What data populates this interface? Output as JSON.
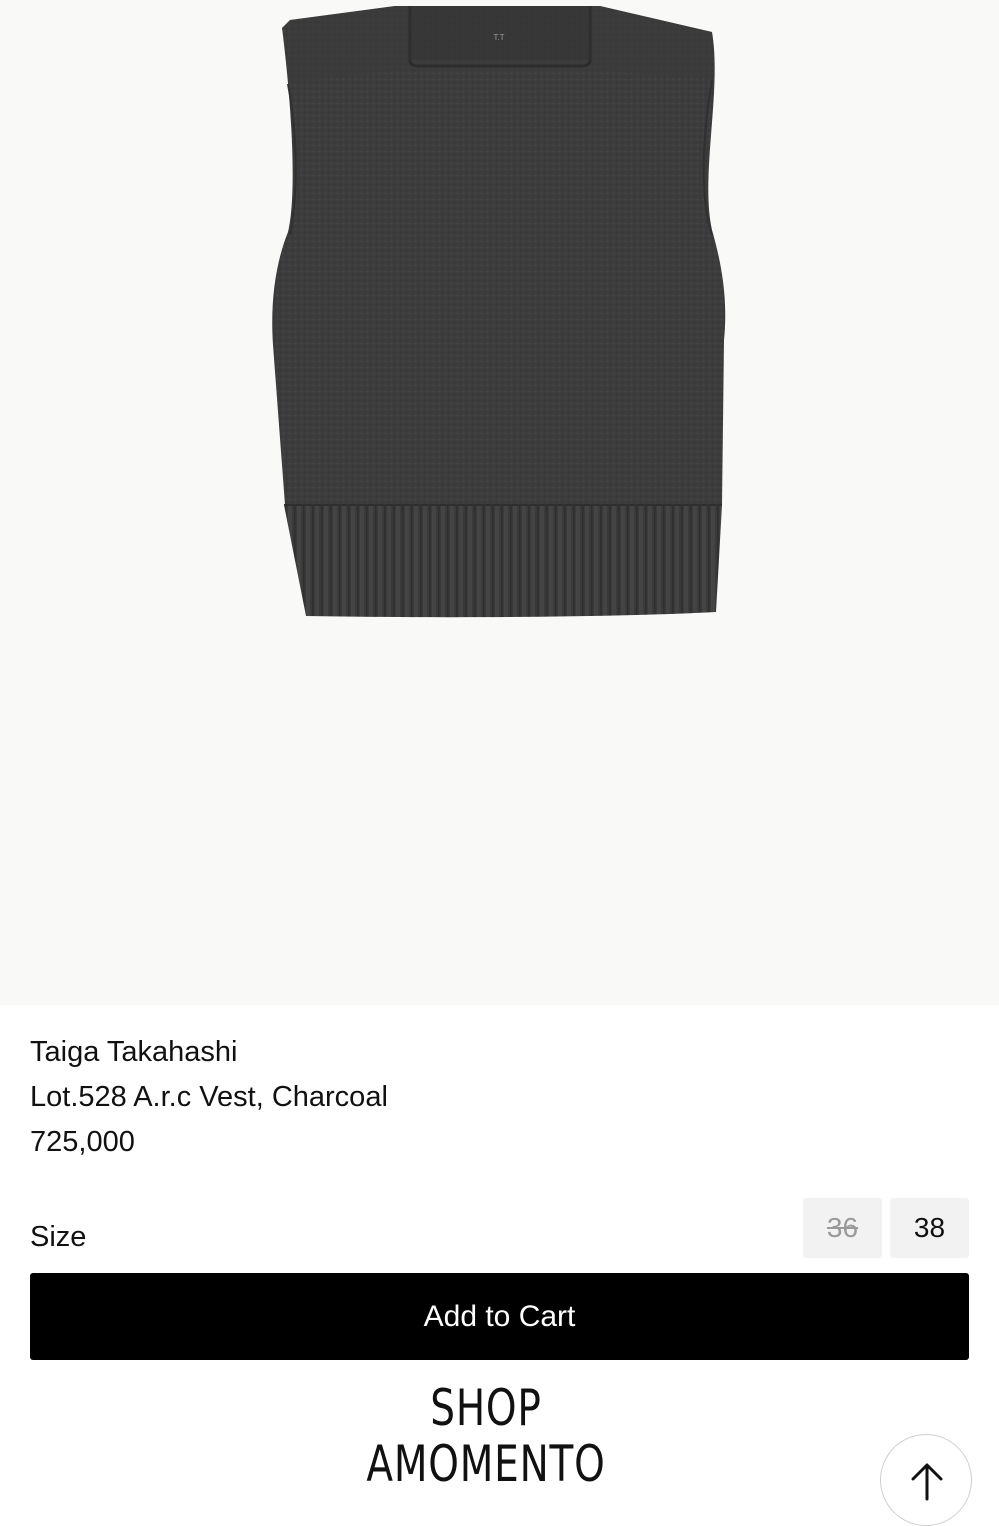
{
  "product": {
    "brand": "Taiga Takahashi",
    "name": "Lot.528 A.r.c Vest, Charcoal",
    "price": "725,000",
    "label_tag": "T.T",
    "image_background": "#f9f9f7",
    "garment_color": "#3c3c3d"
  },
  "size_selector": {
    "label": "Size",
    "options": [
      {
        "label": "36",
        "available": false
      },
      {
        "label": "38",
        "available": true
      }
    ]
  },
  "cart": {
    "add_label": "Add to Cart"
  },
  "footer": {
    "logo_line1": "SHOP",
    "logo_line2": "AMOMENTO"
  },
  "icons": {
    "scroll_top": "arrow-up-icon"
  }
}
